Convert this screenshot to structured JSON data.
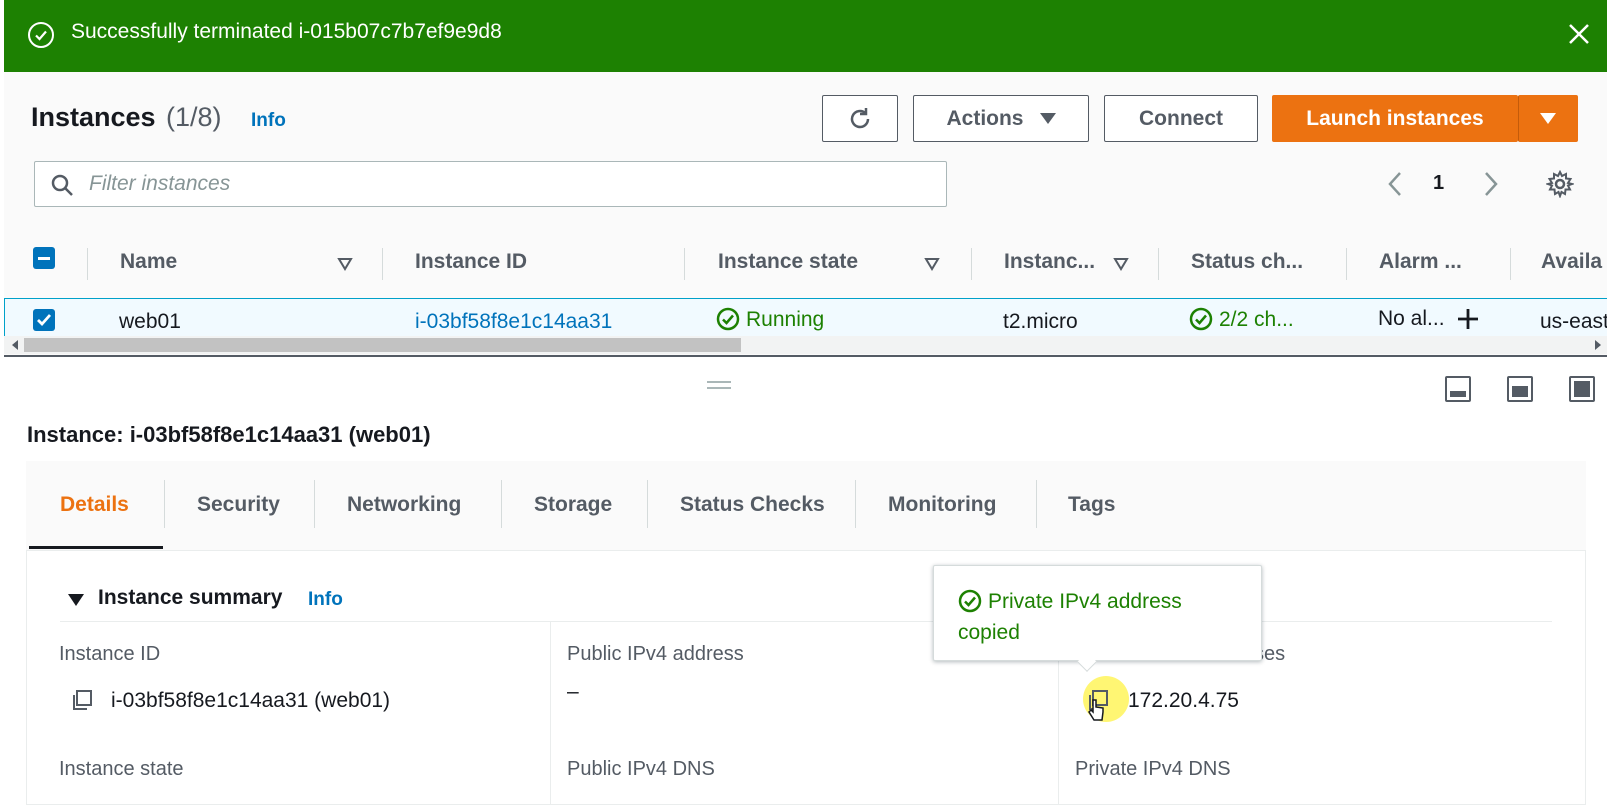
{
  "flash": {
    "message": "Successfully terminated i-015b07c7b7ef9e9d8",
    "icon": "check-circle-icon",
    "close_icon": "close-icon",
    "color": "#1d8102"
  },
  "header": {
    "title": "Instances",
    "count": "(1/8)",
    "info": "Info"
  },
  "toolbar": {
    "refresh_icon": "refresh-icon",
    "actions_label": "Actions",
    "connect_label": "Connect",
    "launch_label": "Launch instances",
    "launch_color": "#ec7211"
  },
  "filter": {
    "placeholder": "Filter instances",
    "value": ""
  },
  "pagination": {
    "page": "1"
  },
  "table": {
    "columns": [
      "Name",
      "Instance ID",
      "Instance state",
      "Instanc...",
      "Status ch...",
      "Alarm ...",
      "Availa"
    ],
    "rows": [
      {
        "name": "web01",
        "instance_id": "i-03bf58f8e1c14aa31",
        "state": "Running",
        "type": "t2.micro",
        "status_check": "2/2 ch...",
        "alarm": "No al...",
        "az": "us-east"
      }
    ]
  },
  "details": {
    "title": "Instance: i-03bf58f8e1c14aa31 (web01)",
    "tabs": [
      "Details",
      "Security",
      "Networking",
      "Storage",
      "Status Checks",
      "Monitoring",
      "Tags"
    ],
    "active_tab": "Details",
    "section_title": "Instance summary",
    "section_info": "Info",
    "fields": {
      "instance_id_label": "Instance ID",
      "instance_id_value": "i-03bf58f8e1c14aa31 (web01)",
      "public_ipv4_label": "Public IPv4 address",
      "public_ipv4_value": "–",
      "private_ipv4_label_visible": "sses",
      "private_ipv4_value": "172.20.4.75",
      "instance_state_label": "Instance state",
      "public_dns_label": "Public IPv4 DNS",
      "private_dns_label": "Private IPv4 DNS"
    },
    "popover": "Private IPv4 address copied"
  }
}
